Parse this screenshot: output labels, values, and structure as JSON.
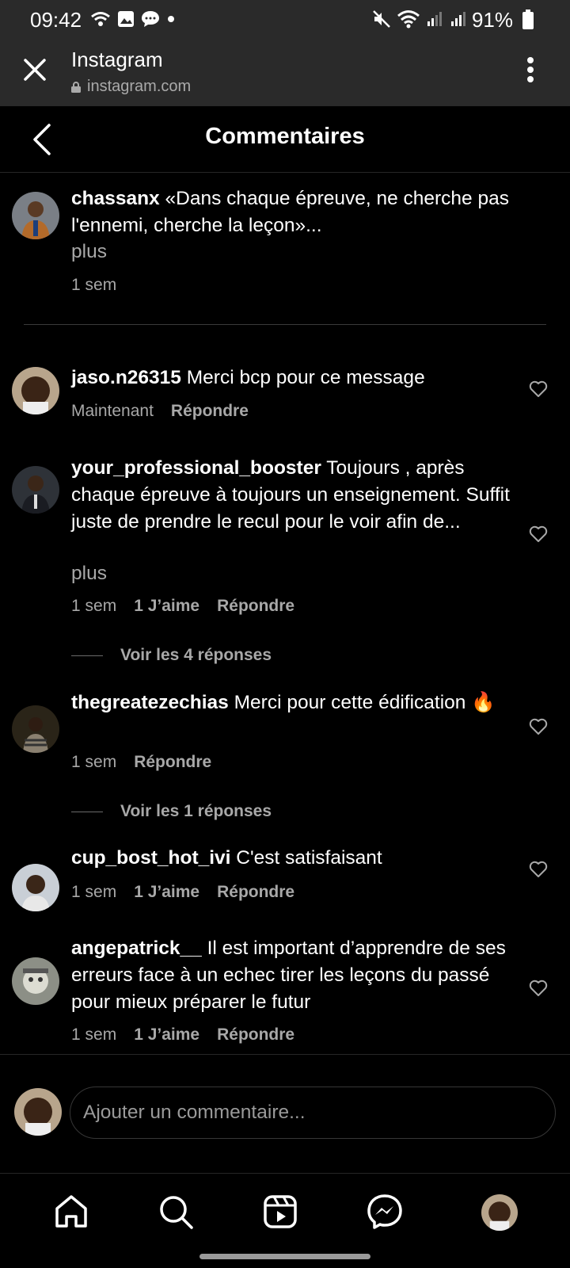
{
  "status_bar": {
    "time": "09:42",
    "battery": "91%"
  },
  "browser": {
    "title": "Instagram",
    "url": "instagram.com"
  },
  "header": {
    "title": "Commentaires"
  },
  "caption": {
    "username": "chassanx",
    "text": "«Dans chaque épreuve, ne cherche pas l'ennemi, cherche la leçon»...",
    "more": "plus",
    "time": "1 sem"
  },
  "comments": [
    {
      "username": "jaso.n26315",
      "text": "Merci bcp pour ce message",
      "time": "Maintenant",
      "likes": "",
      "reply": "Répondre"
    },
    {
      "username": "your_professional_booster",
      "text": "Toujours , après chaque épreuve à toujours un enseignement. Suffit juste de prendre le recul pour le voir afin de...",
      "more": "plus",
      "time": "1 sem",
      "likes": "1 J’aime",
      "reply": "Répondre",
      "view_replies": "Voir les 4 réponses"
    },
    {
      "username": "thegreatezechias",
      "text": "Merci pour cette édification 🔥",
      "time": "1 sem",
      "likes": "",
      "reply": "Répondre",
      "view_replies": "Voir les 1 réponses"
    },
    {
      "username": "cup_bost_hot_ivi",
      "text": "C'est satisfaisant",
      "time": "1 sem",
      "likes": "1 J’aime",
      "reply": "Répondre"
    },
    {
      "username": "angepatrick__",
      "text": "Il est important d’apprendre de ses erreurs face à un echec tirer les leçons du passé pour mieux préparer le futur",
      "time": "1 sem",
      "likes": "1 J’aime",
      "reply": "Répondre"
    }
  ],
  "compose": {
    "placeholder": "Ajouter un commentaire..."
  },
  "nav_icons": [
    "home-icon",
    "search-icon",
    "reels-icon",
    "messenger-icon",
    "profile-avatar"
  ],
  "colors": {
    "background": "#000000",
    "chrome": "#2a2a2a",
    "secondary_text": "#a8a8a8"
  }
}
